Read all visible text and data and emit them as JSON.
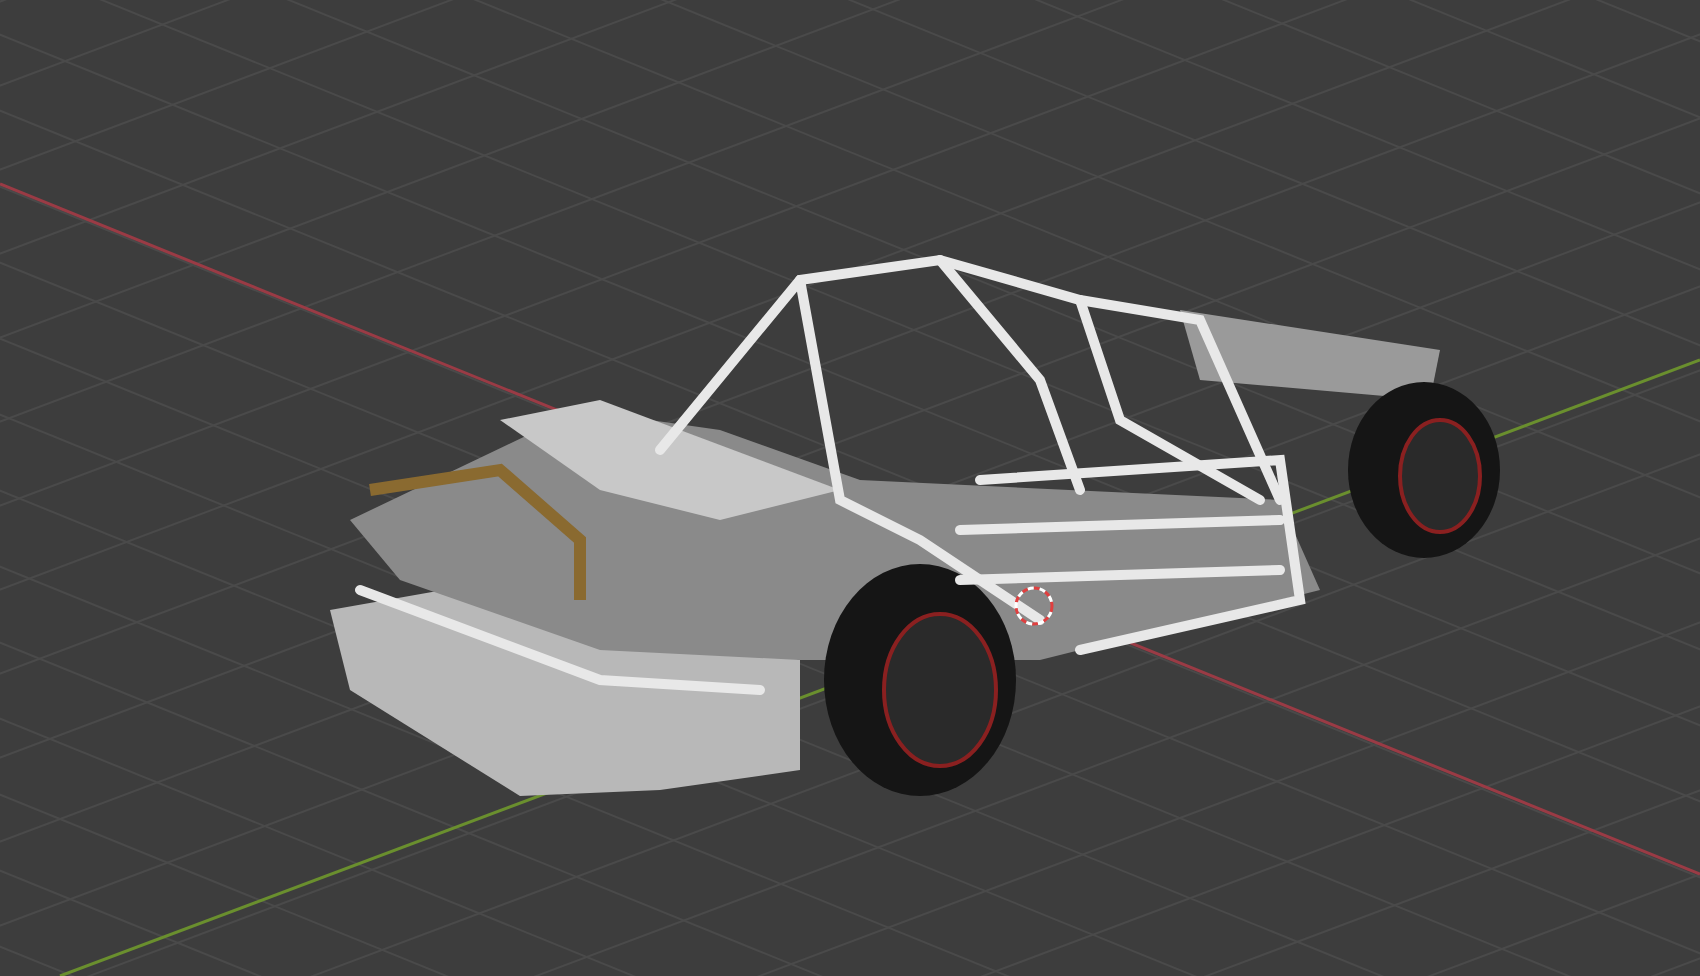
{
  "viewport": {
    "show_axes": true,
    "show_cursor": true
  }
}
